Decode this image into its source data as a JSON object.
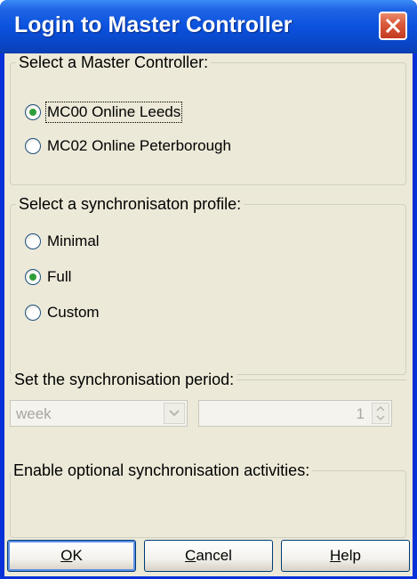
{
  "window": {
    "title": "Login to Master Controller"
  },
  "master_controller": {
    "label": "Select a Master Controller:",
    "options": [
      {
        "label": "MC00  Online Leeds",
        "selected": true
      },
      {
        "label": "MC02  Online Peterborough",
        "selected": false
      }
    ]
  },
  "profile": {
    "label": "Select a synchronisaton profile:",
    "options": [
      {
        "label": "Minimal",
        "selected": false
      },
      {
        "label": "Full",
        "selected": true
      },
      {
        "label": "Custom",
        "selected": false
      }
    ]
  },
  "period": {
    "label": "Set the synchronisation period:",
    "unit_value": "week",
    "amount_value": "1",
    "disabled": true
  },
  "activities": {
    "label": "Enable optional synchronisation activities:"
  },
  "buttons": {
    "ok": {
      "mnemonic": "O",
      "rest": "K"
    },
    "cancel": {
      "mnemonic": "C",
      "rest": "ancel"
    },
    "help": {
      "mnemonic": "H",
      "rest": "elp"
    }
  },
  "colors": {
    "titlebar": "#0a52de",
    "dialog_bg": "#ece9d8",
    "close_button": "#d9573a",
    "radio_check": "#2f9e3a"
  },
  "icons": {
    "close": "close-icon",
    "combo": "chevron-down-icon",
    "spinner": "spin-arrows-icon"
  }
}
